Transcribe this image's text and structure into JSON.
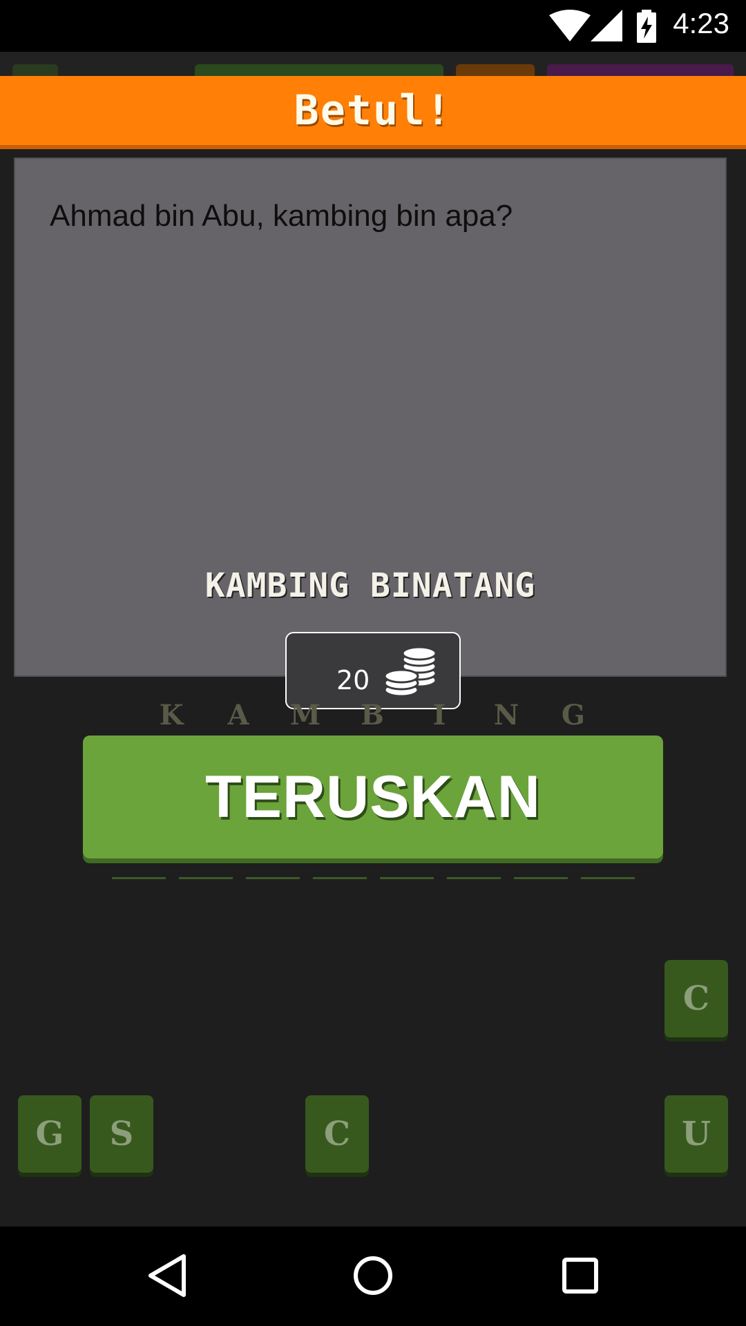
{
  "status_bar": {
    "time": "4:23",
    "icons": [
      "wifi-icon",
      "signal-icon",
      "battery-charging-icon"
    ]
  },
  "banner": {
    "title": "Betul!"
  },
  "question_panel": {
    "question": "Ahmad bin Abu, kambing bin apa?",
    "answer": "KAMBING BINATANG",
    "reward": {
      "amount": "20",
      "icon": "coins-icon"
    }
  },
  "answer_letters": [
    "K",
    "A",
    "M",
    "B",
    "I",
    "N",
    "G"
  ],
  "continue_button": {
    "label": "TERUSKAN"
  },
  "letter_tiles": [
    "C",
    "G",
    "S",
    "C",
    "U"
  ],
  "nav_bar": {
    "icons": [
      "back-icon",
      "home-icon",
      "recents-icon"
    ]
  },
  "colors": {
    "banner": "#ff7f07",
    "panel": "#666468",
    "button": "#6ba43b",
    "tile": "#37591e"
  }
}
